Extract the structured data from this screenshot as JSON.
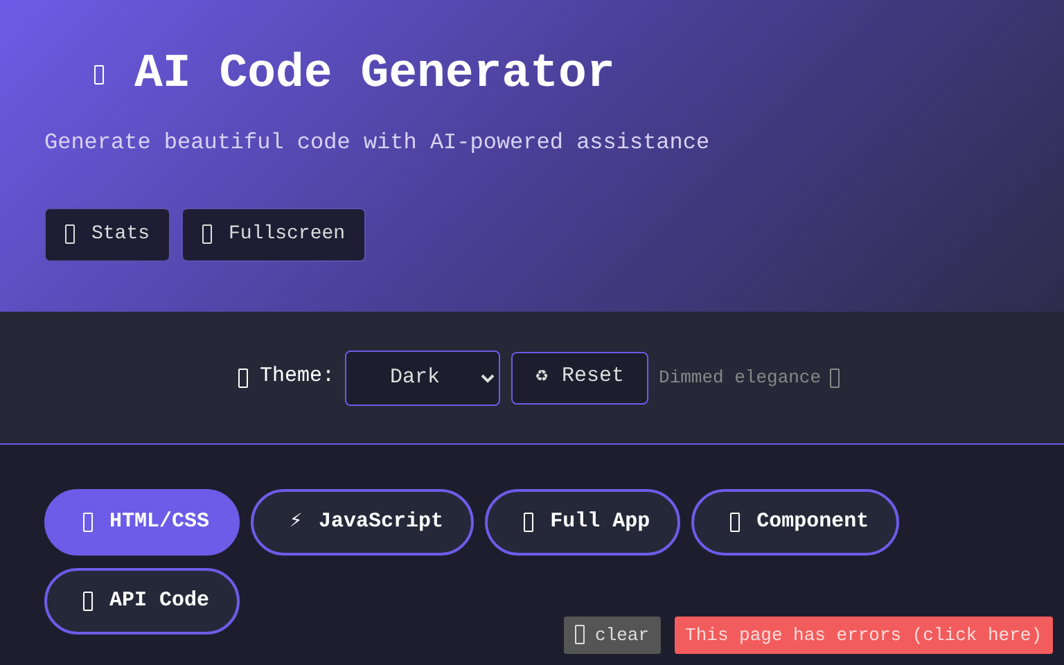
{
  "header": {
    "title": "AI Code Generator",
    "subtitle": "Generate beautiful code with AI-powered assistance",
    "buttons": [
      {
        "label": "Stats"
      },
      {
        "label": "Fullscreen"
      }
    ]
  },
  "theme_bar": {
    "label": "Theme:",
    "select_value": "Dark",
    "reset": {
      "icon": "♻",
      "label": "Reset"
    },
    "description": "Dimmed elegance"
  },
  "tabs": [
    {
      "label": "HTML/CSS",
      "selected": true
    },
    {
      "label": "JavaScript",
      "icon": "⚡",
      "selected": false
    },
    {
      "label": "Full App",
      "selected": false
    },
    {
      "label": "Component",
      "selected": false
    },
    {
      "label": "API Code",
      "selected": false
    }
  ],
  "error_overlay": {
    "clear": "clear",
    "message": "This page has errors (click here)"
  }
}
